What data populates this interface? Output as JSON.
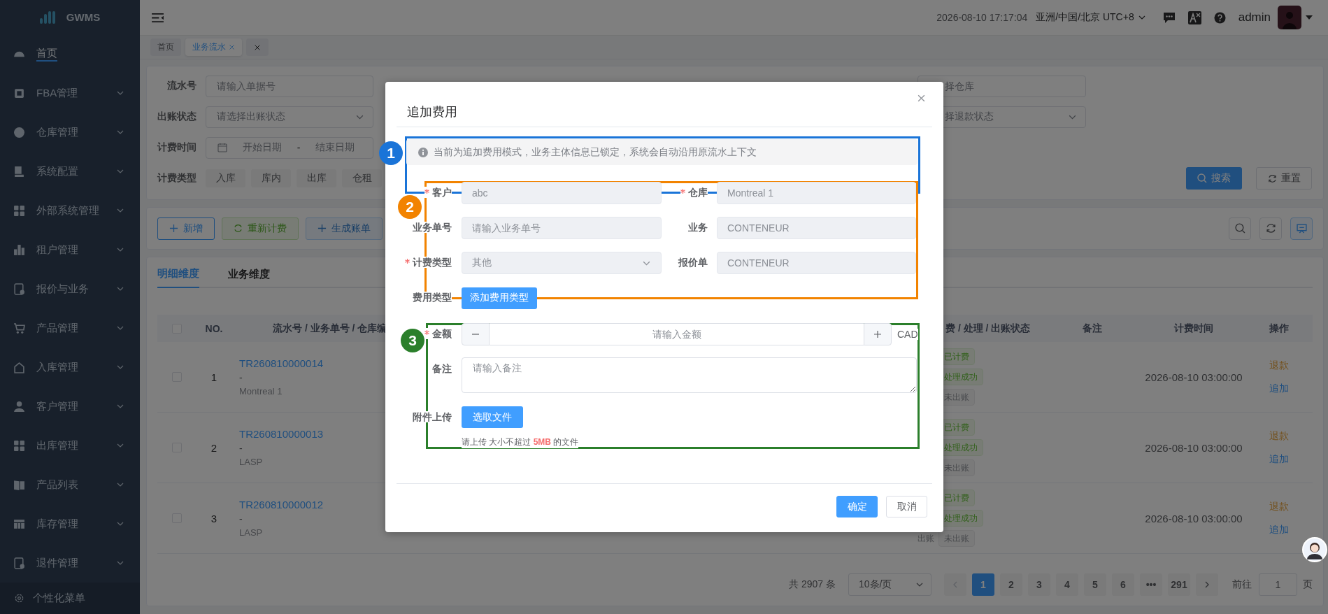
{
  "sidebar": {
    "logo": "GWMS",
    "items": [
      {
        "label": "首页",
        "selected": true,
        "expandable": false
      },
      {
        "label": "FBA管理",
        "selected": false,
        "expandable": true
      },
      {
        "label": "仓库管理",
        "selected": false,
        "expandable": true
      },
      {
        "label": "系统配置",
        "selected": false,
        "expandable": true
      },
      {
        "label": "外部系统管理",
        "selected": false,
        "expandable": true
      },
      {
        "label": "租户管理",
        "selected": false,
        "expandable": true
      },
      {
        "label": "报价与业务",
        "selected": false,
        "expandable": true
      },
      {
        "label": "产品管理",
        "selected": false,
        "expandable": true
      },
      {
        "label": "入库管理",
        "selected": false,
        "expandable": true
      },
      {
        "label": "客户管理",
        "selected": false,
        "expandable": true
      },
      {
        "label": "出库管理",
        "selected": false,
        "expandable": true
      },
      {
        "label": "产品列表",
        "selected": false,
        "expandable": true
      },
      {
        "label": "库存管理",
        "selected": false,
        "expandable": true
      },
      {
        "label": "退件管理",
        "selected": false,
        "expandable": true
      }
    ],
    "footer": "个性化菜单"
  },
  "header": {
    "datetime": "2026-08-10 17:17:04",
    "timezone": "亚洲/中国/北京 UTC+8",
    "user": "admin"
  },
  "page_tabs": [
    {
      "label": "首页",
      "selected": false,
      "closable": false
    },
    {
      "label": "业务流水",
      "selected": true,
      "closable": true
    }
  ],
  "filters": {
    "fields": [
      {
        "label": "流水号",
        "kind": "input",
        "placeholder": "请输入单据号"
      },
      {
        "label": "出账状态",
        "kind": "select",
        "placeholder": "请选择出账状态"
      },
      {
        "label": "计费时间",
        "kind": "daterange",
        "start_placeholder": "开始日期",
        "separator": "-",
        "end_placeholder": "结束日期"
      }
    ],
    "fee_type_label": "计费类型",
    "fee_types": [
      "入库",
      "库内",
      "出库",
      "仓租"
    ],
    "right_fields": [
      {
        "kind": "input",
        "placeholder": "择仓库"
      },
      {
        "kind": "select",
        "placeholder": "择退款状态"
      }
    ],
    "search": "搜索",
    "reset": "重置"
  },
  "toolbar": {
    "buttons": [
      {
        "label": "新增",
        "kind": "primary-plain",
        "disabled": false
      },
      {
        "label": "重新计费",
        "kind": "success",
        "disabled": true
      },
      {
        "label": "生成账单",
        "kind": "primary",
        "disabled": true
      }
    ],
    "icon_buttons": [
      {
        "active": false
      },
      {
        "active": false
      },
      {
        "active": true
      }
    ]
  },
  "view_tabs": [
    {
      "label": "明细维度",
      "selected": true
    },
    {
      "label": "业务维度",
      "selected": false
    }
  ],
  "table": {
    "select_all_checked": false,
    "columns": [
      "NO.",
      "流水号 / 业务单号 / 仓库编",
      "费 / 处理 / 出账状态",
      "备注",
      "计费时间",
      "操作"
    ],
    "rows": [
      {
        "checked": false,
        "no": "1",
        "serial": "TR260810000014",
        "business_no": "-",
        "warehouse": "Montreal 1",
        "statuses": [
          {
            "tag": "已计费",
            "kind": "success"
          },
          {
            "tag": "处理成功",
            "kind": "success"
          },
          {
            "tag": "未出账",
            "kind": "info"
          }
        ],
        "time": "2026-08-10 03:00:00",
        "actions": [
          {
            "label": "退款",
            "kind": "warning"
          },
          {
            "label": "追加",
            "kind": "primary"
          }
        ]
      },
      {
        "checked": false,
        "no": "2",
        "serial": "TR260810000013",
        "business_no": "-",
        "warehouse": "LASP",
        "statuses": [
          {
            "tag": "已计费",
            "kind": "success"
          },
          {
            "tag": "处理成功",
            "kind": "success"
          },
          {
            "tag": "未出账",
            "kind": "info"
          }
        ],
        "time": "2026-08-10 03:00:00",
        "actions": [
          {
            "label": "退款",
            "kind": "warning"
          },
          {
            "label": "追加",
            "kind": "primary"
          }
        ]
      },
      {
        "checked": false,
        "no": "3",
        "serial": "TR260810000012",
        "business_no": "-",
        "warehouse": "LASP",
        "statuses": [
          {
            "tag": "已计费",
            "kind": "success"
          },
          {
            "tag": "处理成功",
            "kind": "success"
          },
          {
            "label": "出账",
            "tag": "未出账",
            "kind": "info"
          }
        ],
        "time": "2026-08-10 03:00:00",
        "actions": [
          {
            "label": "退款",
            "kind": "warning"
          },
          {
            "label": "追加",
            "kind": "primary"
          }
        ]
      }
    ]
  },
  "pagination": {
    "total": "共 2907 条",
    "page_size": "10条/页",
    "prev_disabled": true,
    "next_disabled": false,
    "pages": [
      {
        "label": "1",
        "selected": true
      },
      {
        "label": "2",
        "selected": false
      },
      {
        "label": "3",
        "selected": false
      },
      {
        "label": "4",
        "selected": false
      },
      {
        "label": "5",
        "selected": false
      },
      {
        "label": "6",
        "selected": false
      },
      {
        "label": "•••",
        "selected": false
      },
      {
        "label": "291",
        "selected": false
      }
    ],
    "goto_label": "前往",
    "goto_value": "1",
    "page_suffix": "页"
  },
  "modal": {
    "title": "追加费用",
    "notice": "当前为追加费用模式，业务主体信息已锁定，系统会自动沿用原流水上下文",
    "rows": [
      [
        {
          "label": "客户",
          "required": true,
          "kind": "input",
          "value": "abc",
          "disabled": true
        },
        {
          "label": "仓库",
          "required": true,
          "kind": "input",
          "value": "Montreal 1",
          "disabled": true
        }
      ],
      [
        {
          "label": "业务单号",
          "required": false,
          "kind": "input",
          "placeholder": "请输入业务单号",
          "disabled": true
        },
        {
          "label": "业务",
          "required": false,
          "kind": "input",
          "value": "CONTENEUR",
          "disabled": true
        }
      ],
      [
        {
          "label": "计费类型",
          "required": true,
          "kind": "select",
          "value": "其他",
          "disabled": true
        },
        {
          "label": "报价单",
          "required": false,
          "kind": "input",
          "value": "CONTENEUR",
          "disabled": true
        }
      ]
    ],
    "fee_type": {
      "label": "费用类型",
      "button": "添加费用类型"
    },
    "amount": {
      "label": "金额",
      "required": true,
      "placeholder": "请输入金额",
      "currency": "CAD"
    },
    "remark": {
      "label": "备注",
      "placeholder": "请输入备注"
    },
    "attachment": {
      "label": "附件上传",
      "button": "选取文件",
      "hint": "请上传 大小不超过 **5MB** 的文件"
    },
    "buttons": [
      {
        "label": "确定",
        "kind": "primary"
      },
      {
        "label": "取消",
        "kind": "default"
      }
    ]
  },
  "annotations": [
    {
      "number": "1",
      "color": "#1a74d8"
    },
    {
      "number": "2",
      "color": "#f28300"
    },
    {
      "number": "3",
      "color": "#2b7f2b"
    }
  ]
}
